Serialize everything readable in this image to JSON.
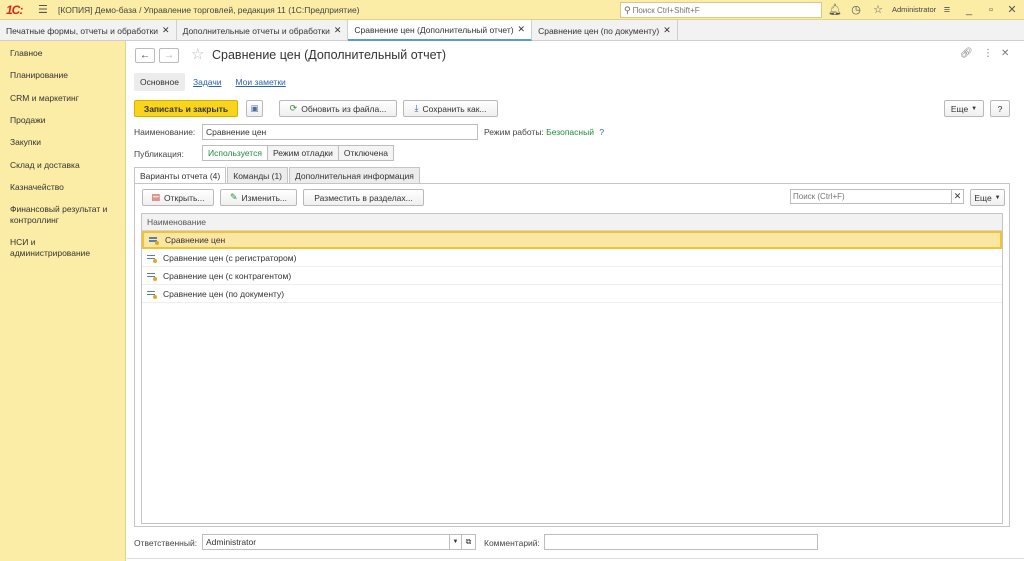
{
  "app": {
    "logo": "1С:",
    "title": "[КОПИЯ] Демо-база / Управление торговлей, редакция 11  (1С:Предприятие)",
    "search_placeholder": "Поиск Ctrl+Shift+F",
    "user": "Administrator"
  },
  "tabs": [
    {
      "label": "Печатные формы, отчеты и обработки"
    },
    {
      "label": "Дополнительные отчеты и обработки"
    },
    {
      "label": "Сравнение цен (Дополнительный отчет)"
    },
    {
      "label": "Сравнение цен (по документу)"
    }
  ],
  "sidebar": {
    "items": [
      {
        "label": "Главное"
      },
      {
        "label": "Планирование"
      },
      {
        "label": "CRM и маркетинг"
      },
      {
        "label": "Продажи"
      },
      {
        "label": "Закупки"
      },
      {
        "label": "Склад и доставка"
      },
      {
        "label": "Казначейство"
      },
      {
        "label": "Финансовый результат и контроллинг"
      },
      {
        "label": "НСИ и администрирование"
      }
    ]
  },
  "form": {
    "title": "Сравнение цен (Дополнительный отчет)",
    "subtabs": [
      "Основное",
      "Задачи",
      "Мои заметки"
    ],
    "toolbar": {
      "save_close": "Записать и закрыть",
      "update_file": "Обновить из файла...",
      "save_as": "Сохранить как...",
      "more": "Еще",
      "help": "?"
    },
    "name_label": "Наименование:",
    "name_value": "Сравнение цен",
    "mode_label": "Режим работы:",
    "mode_value": "Безопасный",
    "mode_help": "?",
    "publication_label": "Публикация:",
    "publication_options": [
      "Используется",
      "Режим отладки",
      "Отключена"
    ],
    "publication_selected": "Используется",
    "page_tabs": [
      "Варианты отчета (4)",
      "Команды (1)",
      "Дополнительная информация"
    ],
    "variants_toolbar": {
      "open": "Открыть...",
      "edit": "Изменить...",
      "place": "Разместить в разделах...",
      "search_placeholder": "Поиск (Ctrl+F)",
      "more": "Еще"
    },
    "grid": {
      "header": "Наименование",
      "rows": [
        "Сравнение цен",
        "Сравнение цен (с регистратором)",
        "Сравнение цен (с контрагентом)",
        "Сравнение цен (по документу)"
      ]
    },
    "responsible_label": "Ответственный:",
    "responsible_value": "Administrator",
    "comment_label": "Комментарий:",
    "comment_value": ""
  },
  "colors": {
    "sidebar_bg": "#fbeda6",
    "primary_button": "#f8d41c",
    "selected_row": "#fbe6a4",
    "link": "#2b61b0",
    "green": "#1e8c3a"
  }
}
